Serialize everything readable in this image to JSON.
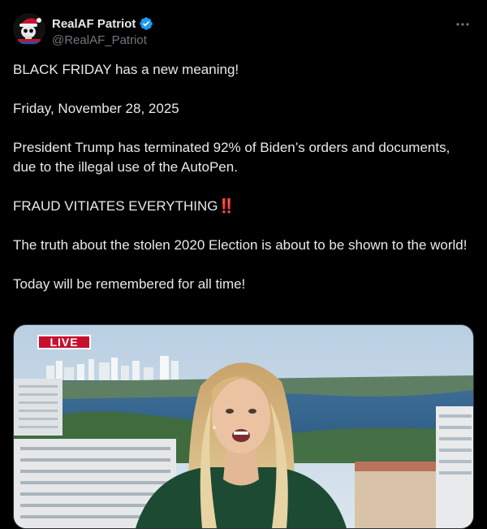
{
  "author": {
    "display_name": "RealAF Patriot",
    "handle": "@RealAF_Patriot",
    "verified": true,
    "verified_color": "#1d9bf0"
  },
  "post": {
    "paragraphs": [
      "BLACK FRIDAY has a new meaning!",
      "Friday, November 28, 2025",
      "President Trump has terminated 92% of Biden’s orders and documents, due to the illegal use of the AutoPen.",
      "FRAUD VITIATES EVERYTHING",
      "The truth about the stolen 2020 Election is about to be shown to the world!",
      "Today will be remembered for all time!"
    ],
    "emphasis_glyph": "‼️"
  },
  "media": {
    "live_label": "LIVE",
    "live_color": "#c8102e"
  },
  "colors": {
    "background": "#000000",
    "text": "#e7e9ea",
    "muted": "#71767b"
  }
}
